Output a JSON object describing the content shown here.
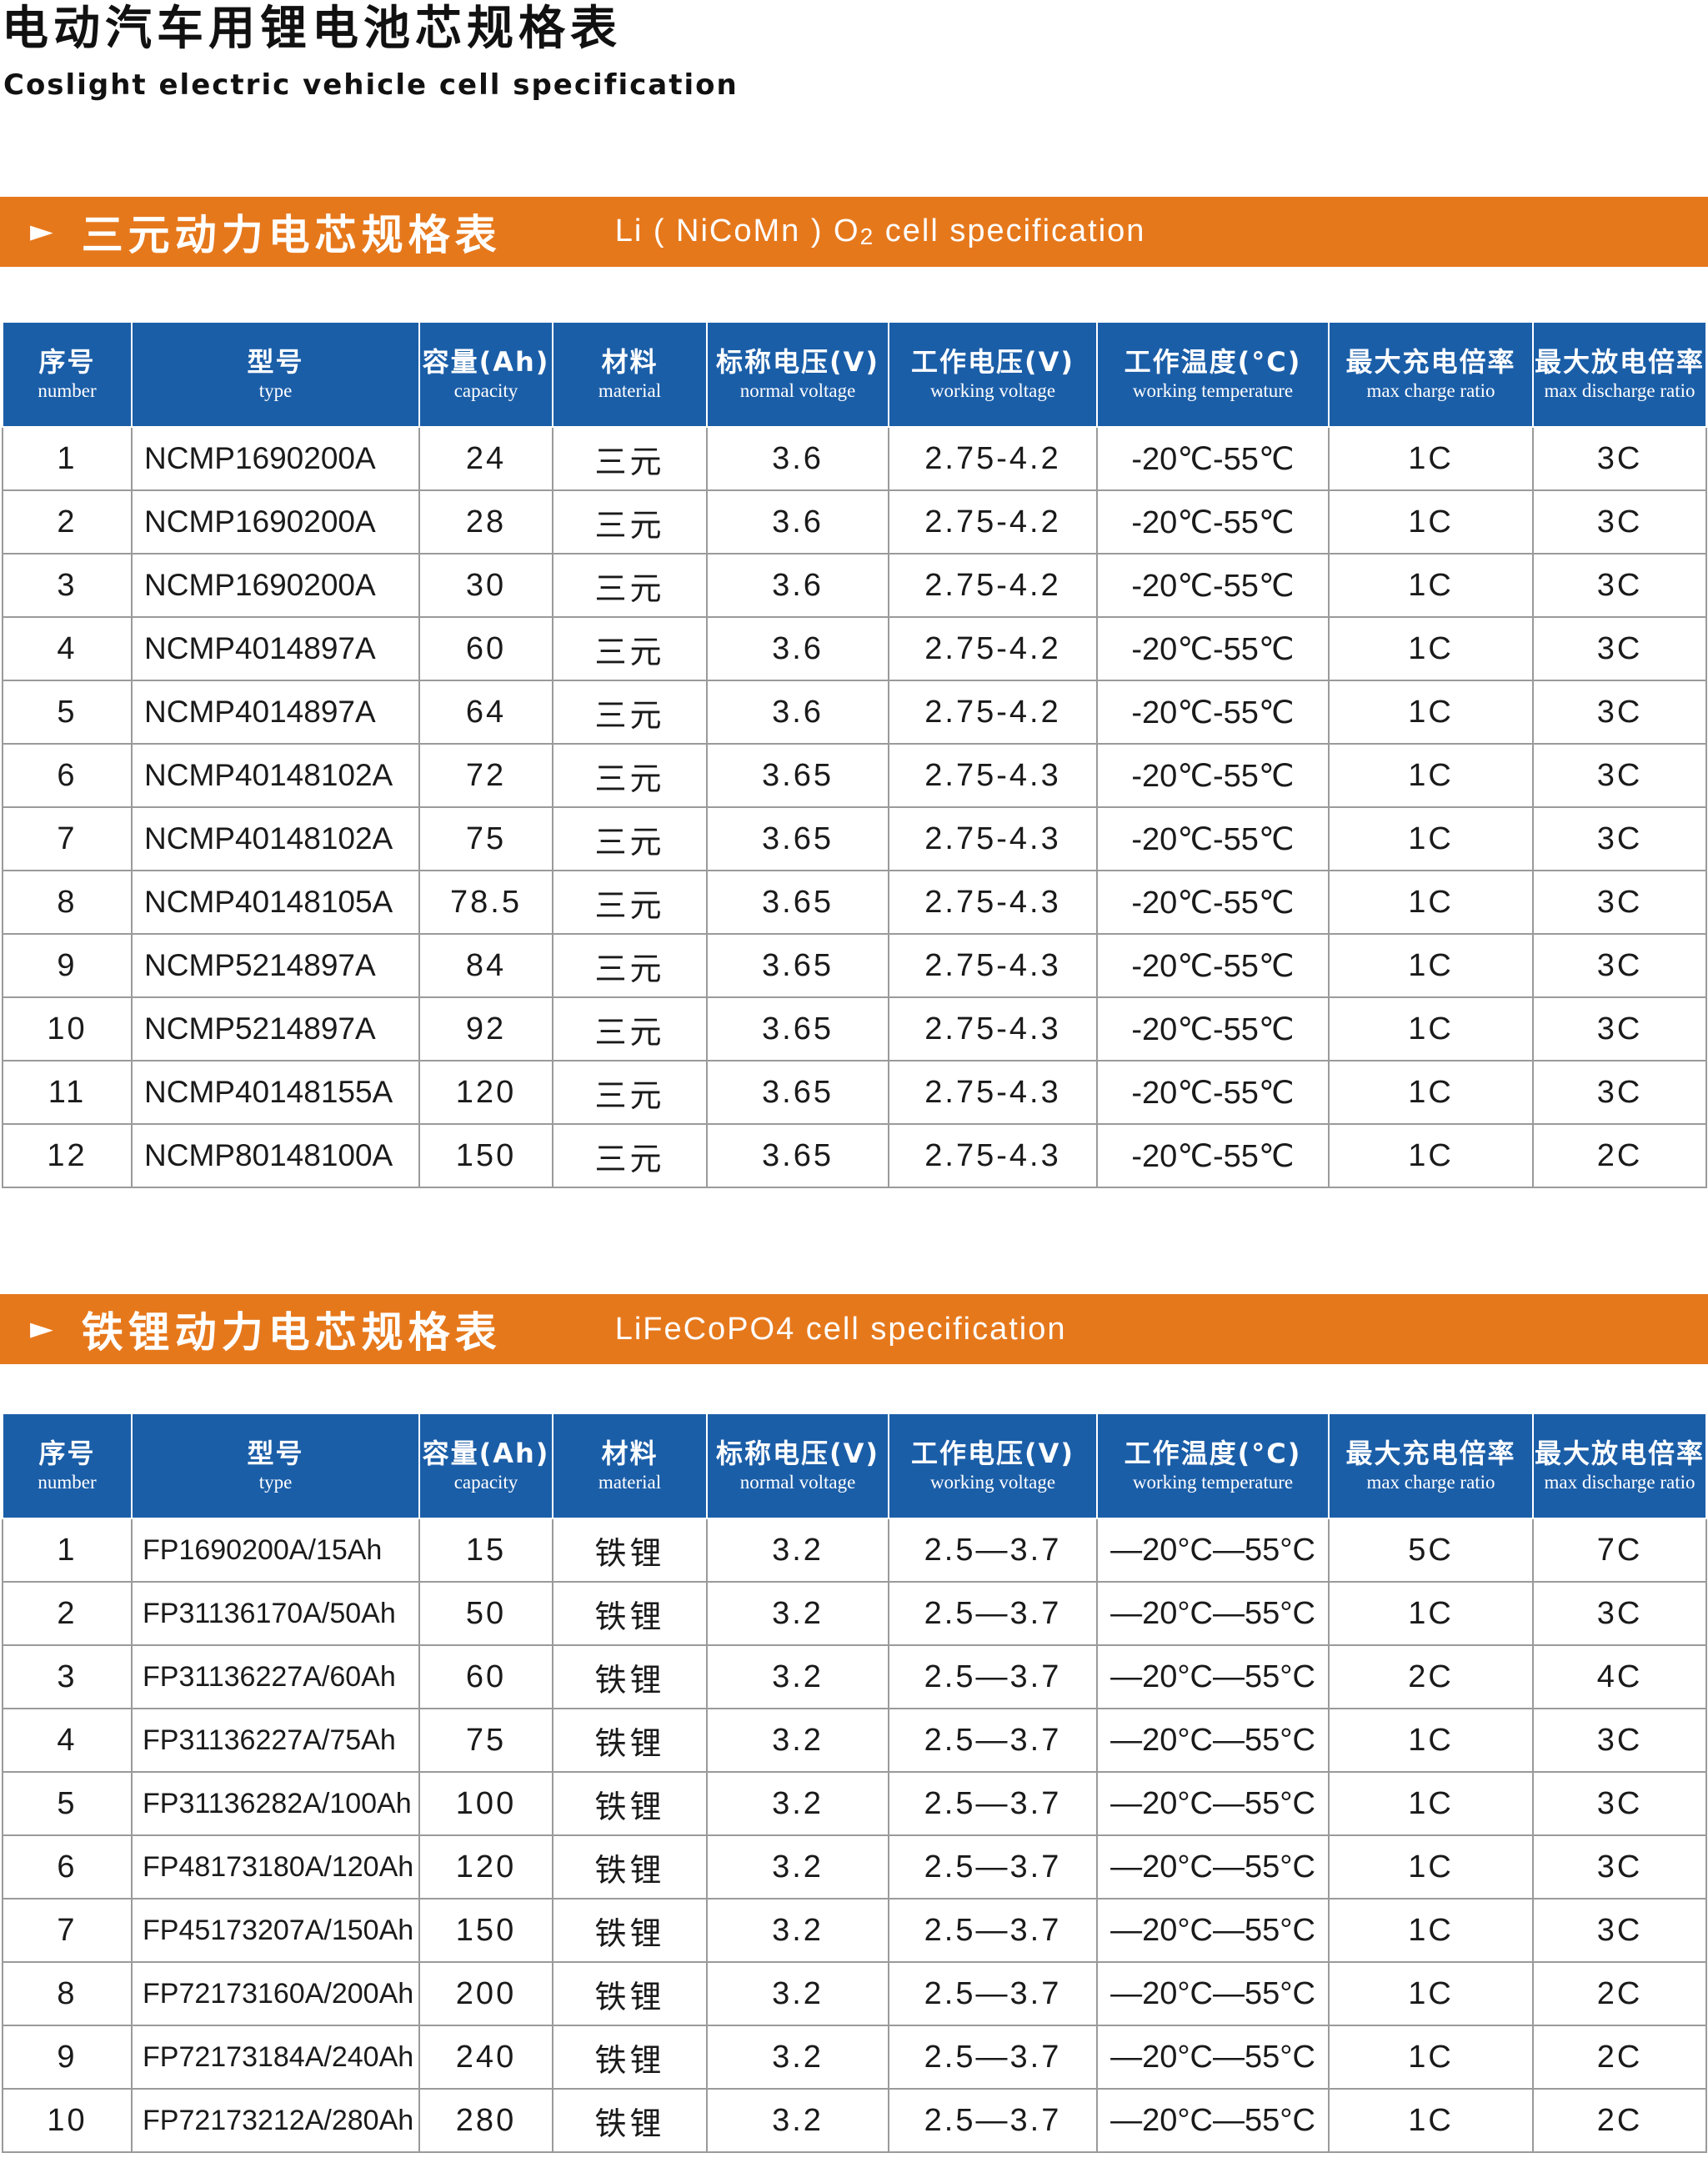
{
  "header": {
    "title": "电动汽车用锂电池芯规格表",
    "subtitle": "Coslight electric vehicle cell specification"
  },
  "columns": {
    "number": {
      "cn": "序号",
      "en": "number"
    },
    "type": {
      "cn": "型号",
      "en": "type"
    },
    "capacity": {
      "cn": "容量(Ah)",
      "en": "capacity"
    },
    "material": {
      "cn": "材料",
      "en": "material"
    },
    "normal_voltage": {
      "cn": "标称电压(V)",
      "en": "normal  voltage"
    },
    "working_voltage": {
      "cn": "工作电压(V)",
      "en": "working voltage"
    },
    "working_temperature": {
      "cn": "工作温度(°C)",
      "en": "working  temperature"
    },
    "max_charge_ratio": {
      "cn": "最大充电倍率",
      "en": "max  charge  ratio"
    },
    "max_discharge_ratio": {
      "cn": "最大放电倍率",
      "en": "max discharge ratio"
    }
  },
  "section_ncm": {
    "arrow": "►",
    "title_cn": "三元动力电芯规格表",
    "title_en_prefix": "Li ( NiCoMn ) O",
    "title_en_sub": "2",
    "title_en_suffix": " cell  specification",
    "rows": [
      {
        "no": "1",
        "model": "NCMP1690200A",
        "capacity": "24",
        "material": "三元",
        "nominal_v": "3.6",
        "working_v": "2.75-4.2",
        "temp": "-20℃-55℃",
        "charge": "1C",
        "discharge": "3C"
      },
      {
        "no": "2",
        "model": "NCMP1690200A",
        "capacity": "28",
        "material": "三元",
        "nominal_v": "3.6",
        "working_v": "2.75-4.2",
        "temp": "-20℃-55℃",
        "charge": "1C",
        "discharge": "3C"
      },
      {
        "no": "3",
        "model": "NCMP1690200A",
        "capacity": "30",
        "material": "三元",
        "nominal_v": "3.6",
        "working_v": "2.75-4.2",
        "temp": "-20℃-55℃",
        "charge": "1C",
        "discharge": "3C"
      },
      {
        "no": "4",
        "model": "NCMP4014897A",
        "capacity": "60",
        "material": "三元",
        "nominal_v": "3.6",
        "working_v": "2.75-4.2",
        "temp": "-20℃-55℃",
        "charge": "1C",
        "discharge": "3C"
      },
      {
        "no": "5",
        "model": "NCMP4014897A",
        "capacity": "64",
        "material": "三元",
        "nominal_v": "3.6",
        "working_v": "2.75-4.2",
        "temp": "-20℃-55℃",
        "charge": "1C",
        "discharge": "3C"
      },
      {
        "no": "6",
        "model": "NCMP40148102A",
        "capacity": "72",
        "material": "三元",
        "nominal_v": "3.65",
        "working_v": "2.75-4.3",
        "temp": "-20℃-55℃",
        "charge": "1C",
        "discharge": "3C"
      },
      {
        "no": "7",
        "model": "NCMP40148102A",
        "capacity": "75",
        "material": "三元",
        "nominal_v": "3.65",
        "working_v": "2.75-4.3",
        "temp": "-20℃-55℃",
        "charge": "1C",
        "discharge": "3C"
      },
      {
        "no": "8",
        "model": "NCMP40148105A",
        "capacity": "78.5",
        "material": "三元",
        "nominal_v": "3.65",
        "working_v": "2.75-4.3",
        "temp": "-20℃-55℃",
        "charge": "1C",
        "discharge": "3C"
      },
      {
        "no": "9",
        "model": "NCMP5214897A",
        "capacity": "84",
        "material": "三元",
        "nominal_v": "3.65",
        "working_v": "2.75-4.3",
        "temp": "-20℃-55℃",
        "charge": "1C",
        "discharge": "3C"
      },
      {
        "no": "10",
        "model": "NCMP5214897A",
        "capacity": "92",
        "material": "三元",
        "nominal_v": "3.65",
        "working_v": "2.75-4.3",
        "temp": "-20℃-55℃",
        "charge": "1C",
        "discharge": "3C"
      },
      {
        "no": "11",
        "model": "NCMP40148155A",
        "capacity": "120",
        "material": "三元",
        "nominal_v": "3.65",
        "working_v": "2.75-4.3",
        "temp": "-20℃-55℃",
        "charge": "1C",
        "discharge": "3C"
      },
      {
        "no": "12",
        "model": "NCMP80148100A",
        "capacity": "150",
        "material": "三元",
        "nominal_v": "3.65",
        "working_v": "2.75-4.3",
        "temp": "-20℃-55℃",
        "charge": "1C",
        "discharge": "2C"
      }
    ]
  },
  "section_lfp": {
    "arrow": "►",
    "title_cn": "铁锂动力电芯规格表",
    "title_en": "LiFeCoPO4 cell  specification",
    "rows": [
      {
        "no": "1",
        "model": "FP1690200A/15Ah",
        "capacity": "15",
        "material": "铁锂",
        "nominal_v": "3.2",
        "working_v": "2.5—3.7",
        "temp": "—20°C—55°C",
        "charge": "5C",
        "discharge": "7C"
      },
      {
        "no": "2",
        "model": "FP31136170A/50Ah",
        "capacity": "50",
        "material": "铁锂",
        "nominal_v": "3.2",
        "working_v": "2.5—3.7",
        "temp": "—20°C—55°C",
        "charge": "1C",
        "discharge": "3C"
      },
      {
        "no": "3",
        "model": "FP31136227A/60Ah",
        "capacity": "60",
        "material": "铁锂",
        "nominal_v": "3.2",
        "working_v": "2.5—3.7",
        "temp": "—20°C—55°C",
        "charge": "2C",
        "discharge": "4C"
      },
      {
        "no": "4",
        "model": "FP31136227A/75Ah",
        "capacity": "75",
        "material": "铁锂",
        "nominal_v": "3.2",
        "working_v": "2.5—3.7",
        "temp": "—20°C—55°C",
        "charge": "1C",
        "discharge": "3C"
      },
      {
        "no": "5",
        "model": "FP31136282A/100Ah",
        "capacity": "100",
        "material": "铁锂",
        "nominal_v": "3.2",
        "working_v": "2.5—3.7",
        "temp": "—20°C—55°C",
        "charge": "1C",
        "discharge": "3C"
      },
      {
        "no": "6",
        "model": "FP48173180A/120Ah",
        "capacity": "120",
        "material": "铁锂",
        "nominal_v": "3.2",
        "working_v": "2.5—3.7",
        "temp": "—20°C—55°C",
        "charge": "1C",
        "discharge": "3C"
      },
      {
        "no": "7",
        "model": "FP45173207A/150Ah",
        "capacity": "150",
        "material": "铁锂",
        "nominal_v": "3.2",
        "working_v": "2.5—3.7",
        "temp": "—20°C—55°C",
        "charge": "1C",
        "discharge": "3C"
      },
      {
        "no": "8",
        "model": "FP72173160A/200Ah",
        "capacity": "200",
        "material": "铁锂",
        "nominal_v": "3.2",
        "working_v": "2.5—3.7",
        "temp": "—20°C—55°C",
        "charge": "1C",
        "discharge": "2C"
      },
      {
        "no": "9",
        "model": "FP72173184A/240Ah",
        "capacity": "240",
        "material": "铁锂",
        "nominal_v": "3.2",
        "working_v": "2.5—3.7",
        "temp": "—20°C—55°C",
        "charge": "1C",
        "discharge": "2C"
      },
      {
        "no": "10",
        "model": "FP72173212A/280Ah",
        "capacity": "280",
        "material": "铁锂",
        "nominal_v": "3.2",
        "working_v": "2.5—3.7",
        "temp": "—20°C—55°C",
        "charge": "1C",
        "discharge": "2C"
      }
    ]
  }
}
